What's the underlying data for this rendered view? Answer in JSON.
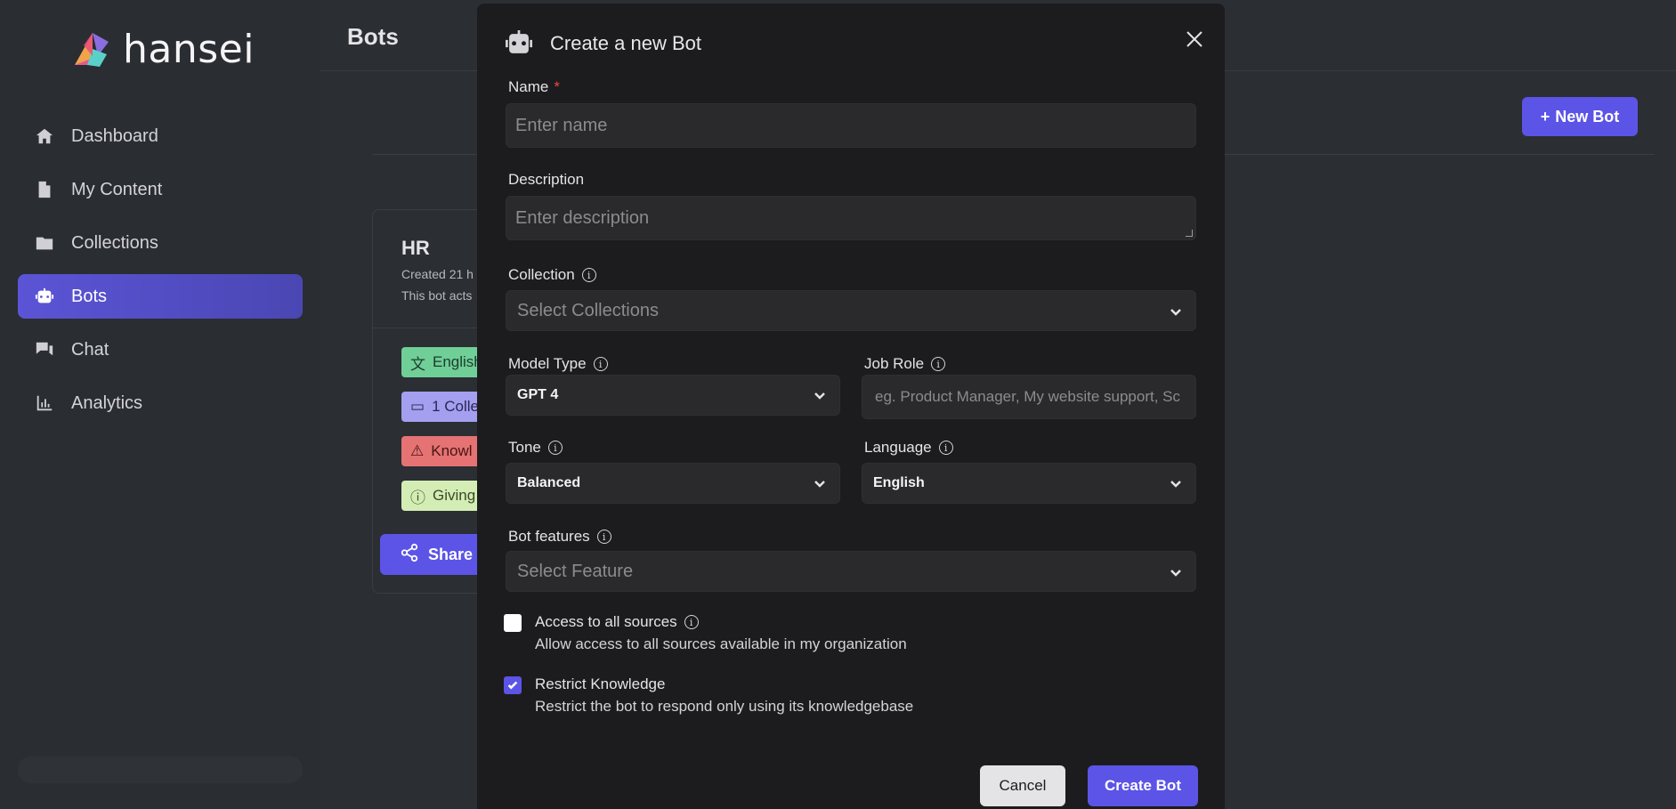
{
  "app": {
    "logo_text": "hansei"
  },
  "sidebar": {
    "items": [
      {
        "label": "Dashboard",
        "icon": "home-icon",
        "active": false
      },
      {
        "label": "My Content",
        "icon": "file-icon",
        "active": false
      },
      {
        "label": "Collections",
        "icon": "folder-icon",
        "active": false
      },
      {
        "label": "Bots",
        "icon": "robot-icon",
        "active": true
      },
      {
        "label": "Chat",
        "icon": "chat-icon",
        "active": false
      },
      {
        "label": "Analytics",
        "icon": "chart-icon",
        "active": false
      }
    ]
  },
  "main": {
    "title": "Bots",
    "new_bot_label": "New Bot",
    "card": {
      "title": "HR",
      "created": "Created 21 h",
      "desc": "This bot acts",
      "tags": [
        {
          "label": "English",
          "icon": "translate-icon",
          "bg": "#6fcf97",
          "fg": "#1f3b2c"
        },
        {
          "label": "1 Colle",
          "icon": "folder-icon",
          "bg": "#a59ff0",
          "fg": "#2b2754"
        },
        {
          "label": "Knowl",
          "icon": "warning-icon",
          "bg": "#e57373",
          "fg": "#4a1414"
        },
        {
          "label": "Giving",
          "icon": "info-icon",
          "bg": "#d4edb5",
          "fg": "#3a4a26"
        }
      ],
      "share_label": "Share B"
    }
  },
  "modal": {
    "title": "Create a new Bot",
    "name": {
      "label": "Name",
      "required_mark": "*",
      "placeholder": "Enter name"
    },
    "description": {
      "label": "Description",
      "placeholder": "Enter description"
    },
    "collection": {
      "label": "Collection",
      "placeholder": "Select Collections"
    },
    "model_type": {
      "label": "Model Type",
      "value": "GPT 4"
    },
    "job_role": {
      "label": "Job Role",
      "placeholder": "eg. Product Manager, My website support, Sc"
    },
    "tone": {
      "label": "Tone",
      "value": "Balanced"
    },
    "language": {
      "label": "Language",
      "value": "English"
    },
    "bot_features": {
      "label": "Bot features",
      "placeholder": "Select Feature"
    },
    "access_all": {
      "title": "Access to all sources",
      "desc": "Allow access to all sources available in my organization",
      "checked": false
    },
    "restrict": {
      "title": "Restrict Knowledge",
      "desc": "Restrict the bot to respond only using its knowledgebase",
      "checked": true
    },
    "cancel_label": "Cancel",
    "create_label": "Create Bot"
  },
  "colors": {
    "accent": "#5b54e6",
    "modal_bg": "#1c1c1e",
    "page_bg": "#2b2e33"
  }
}
